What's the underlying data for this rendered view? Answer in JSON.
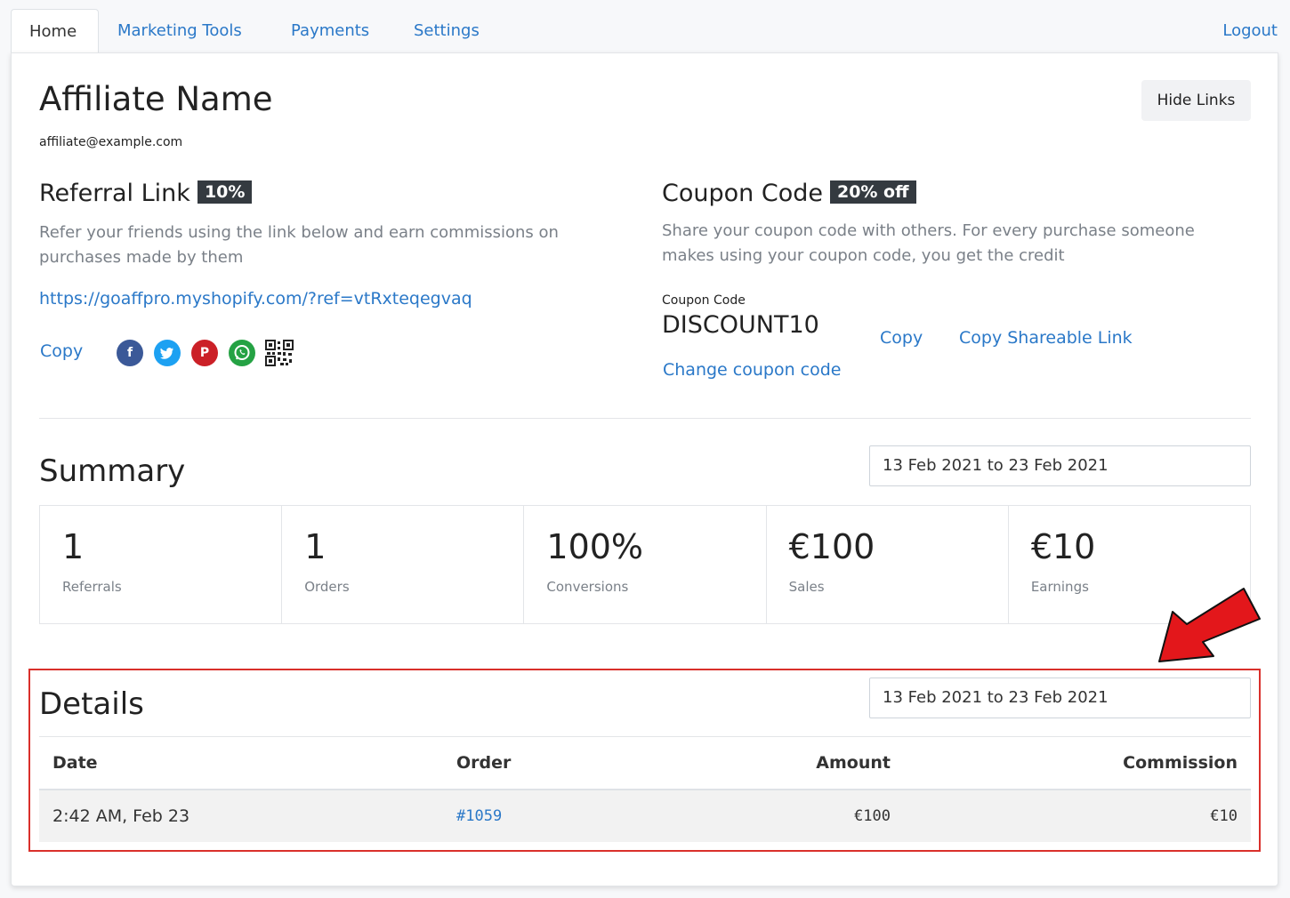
{
  "nav": {
    "tabs": [
      {
        "label": "Home",
        "active": true
      },
      {
        "label": "Marketing Tools"
      },
      {
        "label": "Payments"
      },
      {
        "label": "Settings"
      }
    ],
    "logout": "Logout"
  },
  "profile": {
    "name": "Affiliate Name",
    "email": "affiliate@example.com",
    "hide_links": "Hide Links"
  },
  "referral": {
    "title": "Referral Link",
    "badge": "10%",
    "description": "Refer your friends using the link below and earn commissions on purchases made by them",
    "url": "https://goaffpro.myshopify.com/?ref=vtRxteqegvaq",
    "copy": "Copy",
    "share_icons": [
      "facebook-icon",
      "twitter-icon",
      "pinterest-icon",
      "whatsapp-icon",
      "qr-code-icon"
    ]
  },
  "coupon": {
    "title": "Coupon Code",
    "badge": "20% off",
    "description": "Share your coupon code with others. For every purchase someone makes using your coupon code, you get the credit",
    "label": "Coupon Code",
    "code": "DISCOUNT10",
    "copy": "Copy",
    "copy_share": "Copy Shareable Link",
    "change": "Change coupon code"
  },
  "summary": {
    "title": "Summary",
    "date_range": "13 Feb 2021 to 23 Feb 2021",
    "stats": [
      {
        "value": "1",
        "label": "Referrals"
      },
      {
        "value": "1",
        "label": "Orders"
      },
      {
        "value": "100%",
        "label": "Conversions"
      },
      {
        "value": "€100",
        "label": "Sales"
      },
      {
        "value": "€10",
        "label": "Earnings"
      }
    ]
  },
  "details": {
    "title": "Details",
    "date_range": "13 Feb 2021 to 23 Feb 2021",
    "columns": [
      "Date",
      "Order",
      "Amount",
      "Commission"
    ],
    "rows": [
      {
        "date": "2:42 AM, Feb 23",
        "order": "#1059",
        "amount": "€100",
        "commission": "€10"
      }
    ]
  },
  "colors": {
    "link": "#2a78c8",
    "badge_bg": "#343a40",
    "highlight_border": "#d9302b",
    "arrow": "#e3171b"
  }
}
